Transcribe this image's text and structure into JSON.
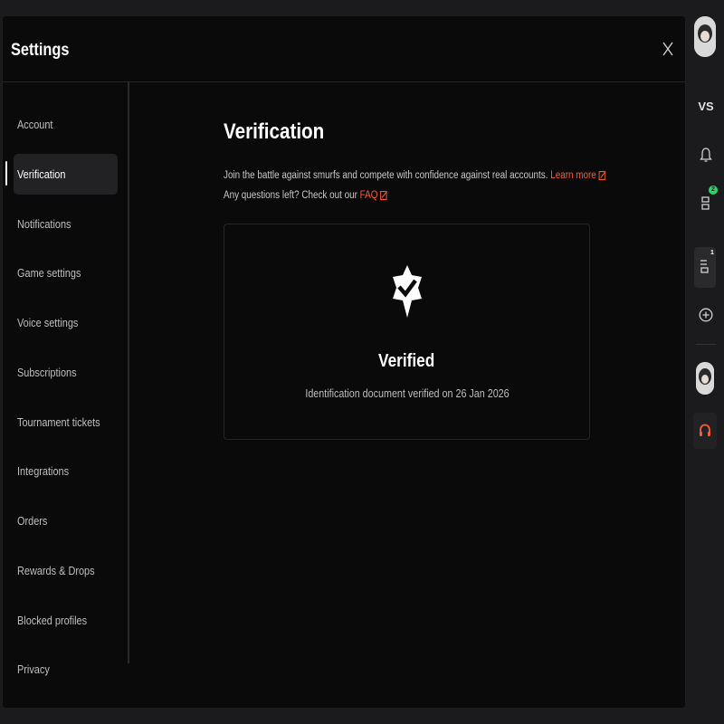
{
  "modal": {
    "title": "Settings"
  },
  "sidebar": {
    "items": [
      {
        "label": "Account"
      },
      {
        "label": "Verification"
      },
      {
        "label": "Notifications"
      },
      {
        "label": "Game settings"
      },
      {
        "label": "Voice settings"
      },
      {
        "label": "Subscriptions"
      },
      {
        "label": "Tournament tickets"
      },
      {
        "label": "Integrations"
      },
      {
        "label": "Orders"
      },
      {
        "label": "Rewards & Drops"
      },
      {
        "label": "Blocked profiles"
      },
      {
        "label": "Privacy"
      }
    ],
    "active_index": 1
  },
  "content": {
    "title": "Verification",
    "description_line1": "Join the battle against smurfs and compete with confidence against real accounts.",
    "learn_more_label": "Learn more",
    "description_line2": "Any questions left? Check out our",
    "faq_label": "FAQ",
    "card": {
      "icon": "verified-badge-icon",
      "heading": "Verified",
      "subtext": "Identification document verified on 26 Jan 2026"
    }
  },
  "rail": {
    "vs_label": "VS",
    "party_badge_count": "2",
    "queue_badge_count": "1"
  },
  "colors": {
    "accent": "#ff5a2e",
    "badge_green": "#2bd46b",
    "background": "#0a0a0a",
    "active_item": "#222224"
  }
}
